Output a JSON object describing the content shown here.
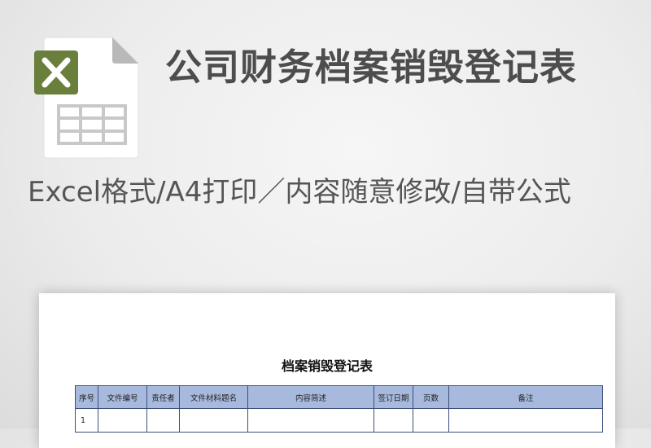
{
  "hero": {
    "title": "公司财务档案销毁登记表",
    "subtitle": "Excel格式/A4打印／内容随意修改/自带公式",
    "icon": "excel-file-icon",
    "accent": "#6a7f3c"
  },
  "document": {
    "title": "档案销毁登记表",
    "header_color": "#a7b9dc",
    "columns": [
      "序号",
      "文件编号",
      "责任者",
      "文件材料题名",
      "内容简述",
      "签订日期",
      "页数",
      "备注"
    ],
    "rows": [
      [
        "1",
        "",
        "",
        "",
        "",
        "",
        "",
        ""
      ]
    ]
  }
}
